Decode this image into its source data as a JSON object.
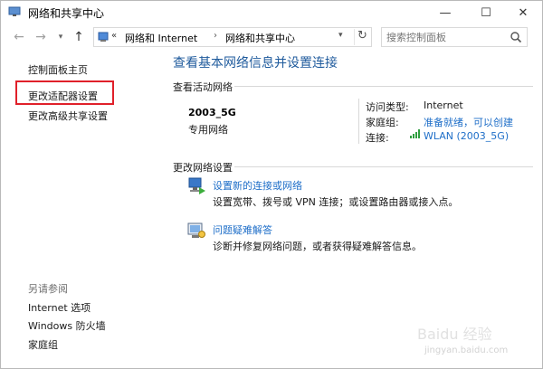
{
  "window": {
    "title": "网络和共享中心"
  },
  "title_controls": {
    "minimize": "—",
    "maximize": "☐",
    "close": "✕"
  },
  "nav": {
    "back": "←",
    "forward": "→",
    "recent": "▾",
    "up": "↑"
  },
  "address": {
    "chevron": "«",
    "crumbs": [
      "网络和 Internet",
      "网络和共享中心"
    ],
    "separator": "›",
    "dropdown": "▾",
    "refresh": "↻"
  },
  "search": {
    "placeholder": "搜索控制面板"
  },
  "left_pane": {
    "links": [
      "控制面板主页",
      "更改适配器设置",
      "更改高级共享设置"
    ],
    "see_also_label": "另请参阅",
    "see_also_links": [
      "Internet 选项",
      "Windows 防火墙",
      "家庭组"
    ],
    "highlight_color": "#e0202a"
  },
  "main": {
    "title": "查看基本网络信息并设置连接",
    "active_networks_label": "查看活动网络",
    "network": {
      "name": "2003_5G",
      "type": "专用网络"
    },
    "details": [
      {
        "key": "访问类型:",
        "value": "Internet",
        "kind": "text"
      },
      {
        "key": "家庭组:",
        "value": "准备就绪，可以创建",
        "kind": "link"
      },
      {
        "key": "连接:",
        "value": "WLAN (2003_5G)",
        "kind": "link"
      }
    ],
    "change_settings_label": "更改网络设置",
    "tasks": [
      {
        "title": "设置新的连接或网络",
        "description": "设置宽带、拨号或 VPN 连接；或设置路由器或接入点。",
        "icon": "network-setup-icon"
      },
      {
        "title": "问题疑难解答",
        "description": "诊断并修复网络问题，或者获得疑难解答信息。",
        "icon": "troubleshoot-icon"
      }
    ]
  },
  "watermark": {
    "text": "Baidu 经验",
    "subtext": "jingyan.baidu.com"
  },
  "colors": {
    "link": "#1e6ec8",
    "title": "#1e5a9c",
    "highlight": "#e0202a"
  }
}
